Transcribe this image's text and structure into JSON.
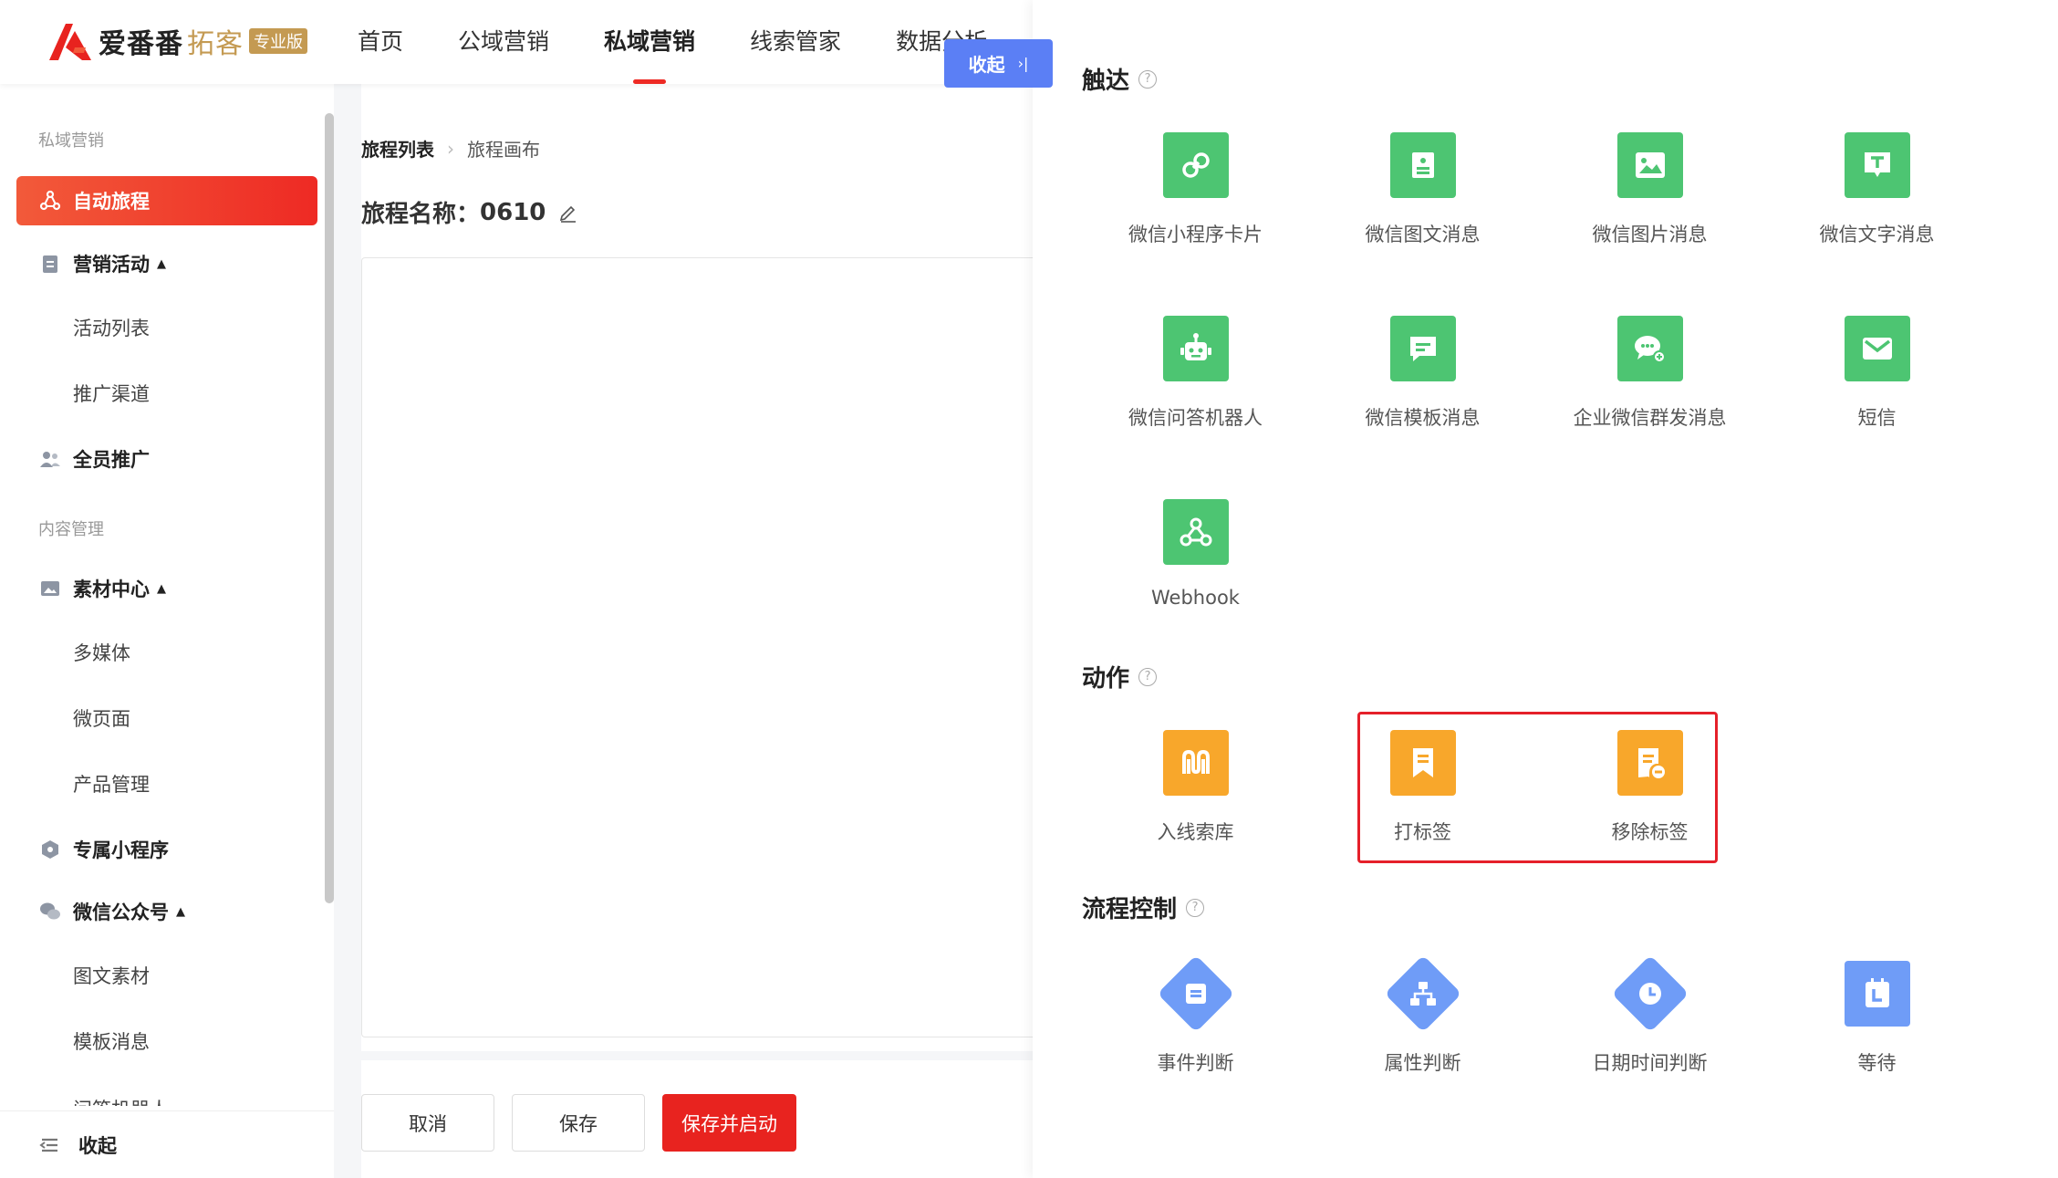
{
  "header": {
    "logo_name": "爱番番",
    "logo_sub": "拓客",
    "logo_badge": "专业版",
    "nav": [
      "首页",
      "公域营销",
      "私域营销",
      "线索管家",
      "数据分析"
    ],
    "active_nav": "私域营销"
  },
  "sidebar": {
    "section1": "私域营销",
    "section2": "内容管理",
    "items": {
      "auto_journey": "自动旅程",
      "marketing": "营销活动",
      "activity_list": "活动列表",
      "promo_channel": "推广渠道",
      "all_staff": "全员推广",
      "material_center": "素材中心",
      "multimedia": "多媒体",
      "micro_page": "微页面",
      "product_mgmt": "产品管理",
      "mini_program": "专属小程序",
      "wechat_oa": "微信公众号",
      "article_material": "图文素材",
      "template_msg": "模板消息",
      "partial_next": "问答机器人"
    },
    "collapse": "收起"
  },
  "main": {
    "crumb_list": "旅程列表",
    "crumb_canvas": "旅程画布",
    "journey_label": "旅程名称：",
    "journey_name": "0610",
    "btn_cancel": "取消",
    "btn_save": "保存",
    "btn_save_start": "保存并启动"
  },
  "collapse_button": "收起",
  "panel": {
    "reach": {
      "title": "触达",
      "items": [
        "微信小程序卡片",
        "微信图文消息",
        "微信图片消息",
        "微信文字消息",
        "微信问答机器人",
        "微信模板消息",
        "企业微信群发消息",
        "短信",
        "Webhook"
      ]
    },
    "action": {
      "title": "动作",
      "items": [
        "入线索库",
        "打标签",
        "移除标签"
      ]
    },
    "flow": {
      "title": "流程控制",
      "items": [
        "事件判断",
        "属性判断",
        "日期时间判断",
        "等待"
      ]
    },
    "help_glyph": "?"
  },
  "colors": {
    "brand_red": "#ee2a24",
    "reach_green": "#4dc572",
    "action_orange": "#f8a72b",
    "flow_blue": "#6f9cf7",
    "collapse_blue": "#5b7ff5",
    "highlight_red": "#e5202a"
  }
}
